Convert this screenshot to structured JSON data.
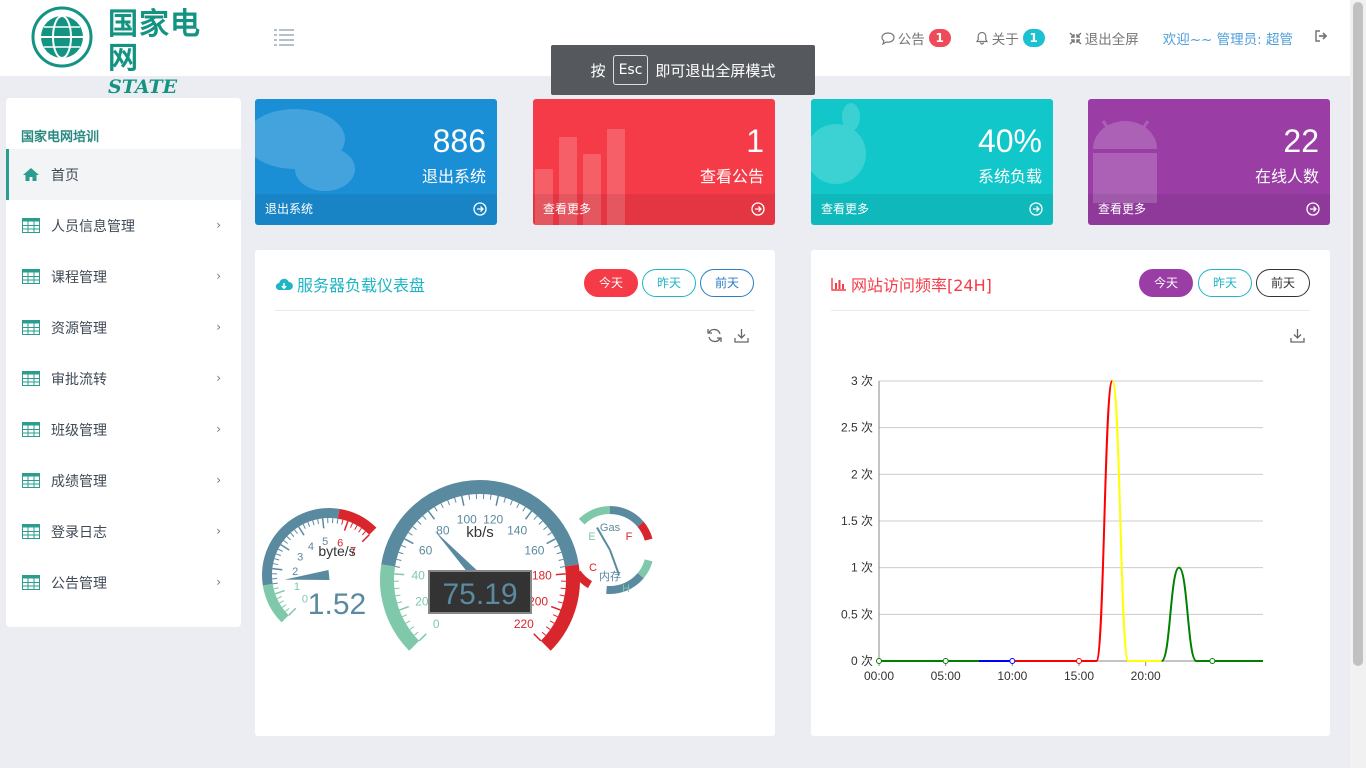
{
  "header": {
    "logo_cn": "国家电网",
    "logo_en": "STATE GRID",
    "nav": {
      "notice_label": "公告",
      "notice_count": "1",
      "about_label": "关于",
      "about_count": "1",
      "exit_fullscreen": "退出全屏",
      "welcome": "欢迎~~ 管理员: 超管"
    }
  },
  "toast": {
    "before": "按",
    "key": "Esc",
    "after": "即可退出全屏模式"
  },
  "sidebar": {
    "title": "国家电网培训",
    "items": [
      {
        "label": "首页",
        "icon": "home-icon"
      },
      {
        "label": "人员信息管理",
        "icon": "table-icon"
      },
      {
        "label": "课程管理",
        "icon": "table-icon"
      },
      {
        "label": "资源管理",
        "icon": "table-icon"
      },
      {
        "label": "审批流转",
        "icon": "table-icon"
      },
      {
        "label": "班级管理",
        "icon": "table-icon"
      },
      {
        "label": "成绩管理",
        "icon": "table-icon"
      },
      {
        "label": "登录日志",
        "icon": "table-icon"
      },
      {
        "label": "公告管理",
        "icon": "table-icon"
      }
    ]
  },
  "stats": [
    {
      "value": "886",
      "label": "退出系统",
      "footer": "退出系统",
      "color": "#1a8fd6"
    },
    {
      "value": "1",
      "label": "查看公告",
      "footer": "查看更多",
      "color": "#f53b47"
    },
    {
      "value": "40%",
      "label": "系统负载",
      "footer": "查看更多",
      "color": "#11c7ca"
    },
    {
      "value": "22",
      "label": "在线人数",
      "footer": "查看更多",
      "color": "#9a3ea6"
    }
  ],
  "gauge_panel": {
    "title": "服务器负载仪表盘",
    "buttons": [
      "今天",
      "昨天",
      "前天"
    ],
    "gauges": {
      "small": {
        "unit": "byte/s",
        "value": 1.52,
        "display": "1.52",
        "min": 0,
        "max": 7,
        "ticks": [
          "0",
          "1",
          "2",
          "3",
          "4",
          "5",
          "6",
          "7"
        ]
      },
      "main": {
        "unit": "kb/s",
        "value": 75.19,
        "display": "75.19",
        "min": 0,
        "max": 220,
        "ticks": [
          "0",
          "20",
          "40",
          "60",
          "80",
          "100",
          "120",
          "140",
          "160",
          "180",
          "200",
          "220"
        ]
      },
      "gas": {
        "label": "Gas",
        "value": 0.5,
        "low": "E",
        "high": "F"
      },
      "mem": {
        "label": "内存",
        "value": 0.5,
        "low": "C",
        "high": "H"
      }
    }
  },
  "chart_panel": {
    "title": "网站访问频率[24H]",
    "buttons": [
      "今天",
      "昨天",
      "前天"
    ]
  },
  "chart_data": {
    "type": "line",
    "title": "网站访问频率[24H]",
    "ylim": [
      0,
      3
    ],
    "y_ticks": [
      "0 次",
      "0.5 次",
      "1 次",
      "1.5 次",
      "2 次",
      "2.5 次",
      "3 次"
    ],
    "x_ticks": [
      "00:00",
      "05:00",
      "10:00",
      "15:00",
      "20:00"
    ],
    "series": [
      {
        "color": "#008000",
        "x": [
          0,
          5,
          7.5
        ],
        "y": [
          0,
          0,
          0
        ]
      },
      {
        "color": "#0000ff",
        "x": [
          7.5,
          10,
          10.2
        ],
        "y": [
          0,
          0,
          0
        ]
      },
      {
        "color": "#ff0000",
        "x": [
          10.2,
          15,
          16.3,
          17.5
        ],
        "y": [
          0,
          0,
          0,
          3
        ]
      },
      {
        "color": "#ffff00",
        "x": [
          17.5,
          18.7,
          21.2
        ],
        "y": [
          3,
          0,
          0
        ]
      },
      {
        "color": "#008000",
        "x": [
          21.2,
          22.5,
          23.8,
          25,
          28.8
        ],
        "y": [
          0,
          1,
          0,
          0,
          0
        ]
      }
    ]
  }
}
